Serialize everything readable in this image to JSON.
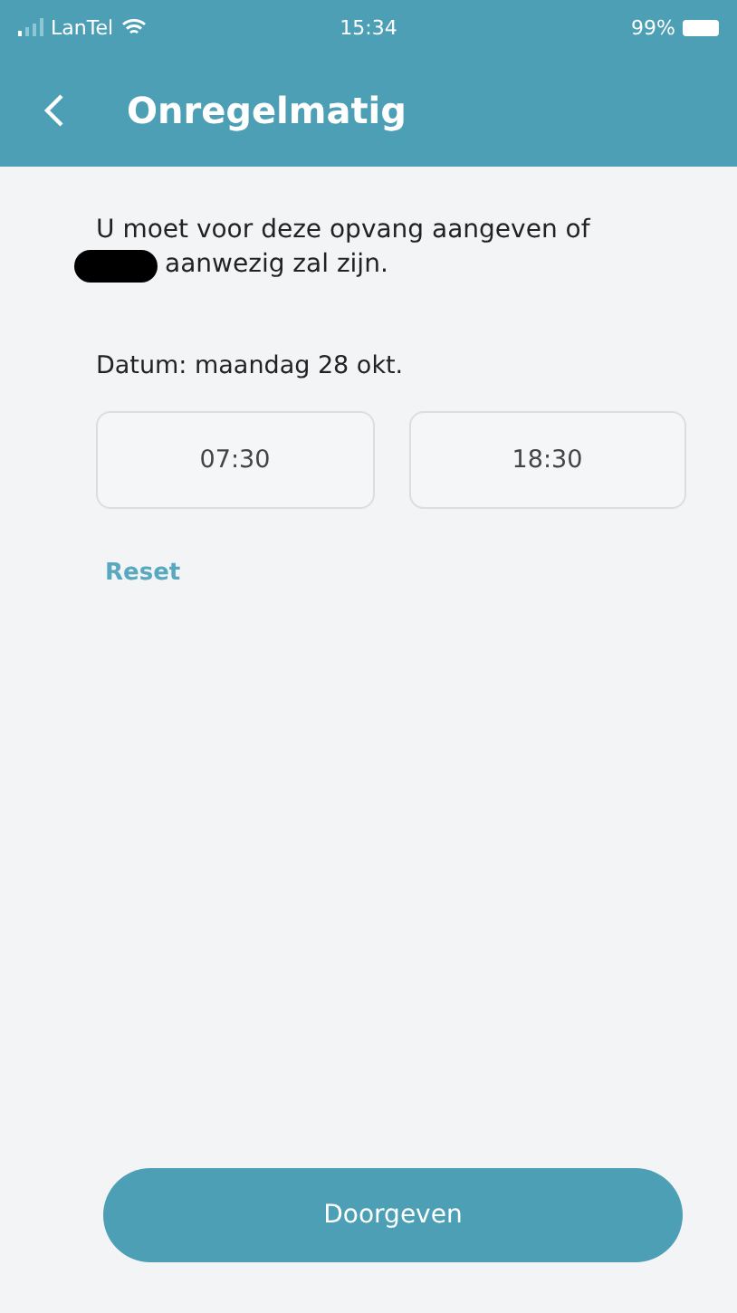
{
  "status_bar": {
    "carrier": "LanTel",
    "time": "15:34",
    "battery": "99%"
  },
  "nav_bar": {
    "title": "Onregelmatig"
  },
  "message": {
    "text_before": "U moet voor deze opvang aangeven of",
    "text_after": "aanwezig zal zijn."
  },
  "date_label": "Datum: maandag 28 okt.",
  "times": [
    {
      "label": "07:30"
    },
    {
      "label": "18:30"
    }
  ],
  "reset_link": "Reset",
  "submit_button": "Doorgeven"
}
